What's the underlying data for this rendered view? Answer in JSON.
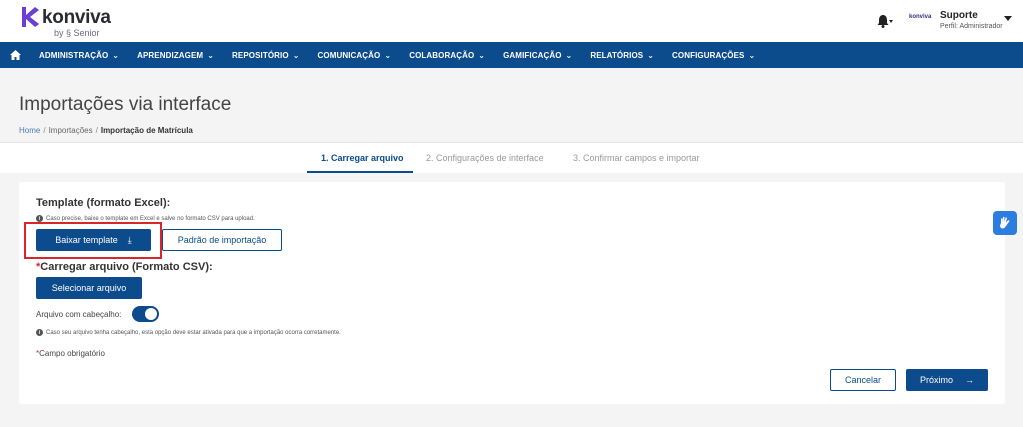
{
  "header": {
    "brand_name": "konviva",
    "brand_sub": "by § Senior",
    "user_mini_logo": "konviva",
    "user_name": "Suporte",
    "user_role": "Perfil: Administrador"
  },
  "nav": {
    "items": [
      {
        "label": "ADMINISTRAÇÃO"
      },
      {
        "label": "APRENDIZAGEM"
      },
      {
        "label": "REPOSITÓRIO"
      },
      {
        "label": "COMUNICAÇÃO"
      },
      {
        "label": "COLABORAÇÃO"
      },
      {
        "label": "GAMIFICAÇÃO"
      },
      {
        "label": "RELATÓRIOS"
      },
      {
        "label": "CONFIGURAÇÕES"
      }
    ]
  },
  "page": {
    "title": "Importações via interface",
    "breadcrumb": [
      "Home",
      "Importações",
      "Importação de Matrícula"
    ]
  },
  "steps": [
    {
      "label": "1. Carregar arquivo",
      "active": true
    },
    {
      "label": "2. Configurações de interface",
      "active": false
    },
    {
      "label": "3. Confirmar campos e importar",
      "active": false
    }
  ],
  "form": {
    "template_title": "Template (formato Excel):",
    "template_info": "Caso precise, baixe o template em Excel e salve no formato CSV para upload.",
    "download_button": "Baixar template",
    "import_pattern_button": "Padrão de importação",
    "upload_asterisk": "*",
    "upload_title": "Carregar arquivo (Formato CSV):",
    "select_file_button": "Selecionar arquivo",
    "header_toggle_label": "Arquivo com cabeçalho:",
    "header_toggle_on": true,
    "header_info": "Caso seu arquivo tenha cabeçalho, esta opção deve estar ativada para que a importação ocorra corretamente.",
    "required_asterisk": "*",
    "required_note": "Campo obrigatório",
    "cancel_button": "Cancelar",
    "next_button": "Próximo"
  },
  "colors": {
    "primary": "#0c4b8c",
    "highlight": "#d9262c",
    "brand_purple": "#6b3fd4"
  }
}
